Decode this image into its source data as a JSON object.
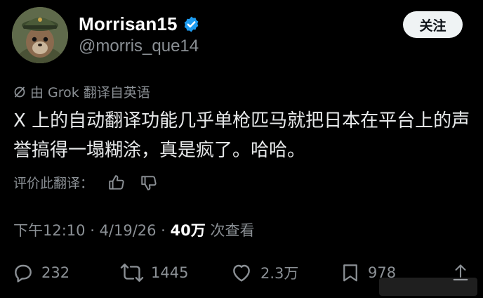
{
  "tweet": {
    "author": {
      "display_name": "Morrisan15",
      "handle": "@morris_que14",
      "verified": true,
      "avatar_icon": "military-marmot-avatar"
    },
    "follow_label": "关注",
    "translation_notice": "由 Grok 翻译自英语",
    "text": "X 上的自动翻译功能几乎单枪匹马就把日本在平台上的声誉搞得一塌糊涂，真是疯了。哈哈。",
    "rate_translation_label": "评价此翻译：",
    "timestamp": "下午12:10 · 4/19/26 · ",
    "views_count": "40万",
    "views_label": " 次查看",
    "actions": {
      "replies": "232",
      "reposts": "1445",
      "likes": "2.3万",
      "bookmarks": "978"
    }
  },
  "colors": {
    "background": "#000000",
    "text": "#e7e9ea",
    "secondary": "#8b9095",
    "verified_blue": "#1d9bf0",
    "follow_bg": "#eff3f4"
  }
}
